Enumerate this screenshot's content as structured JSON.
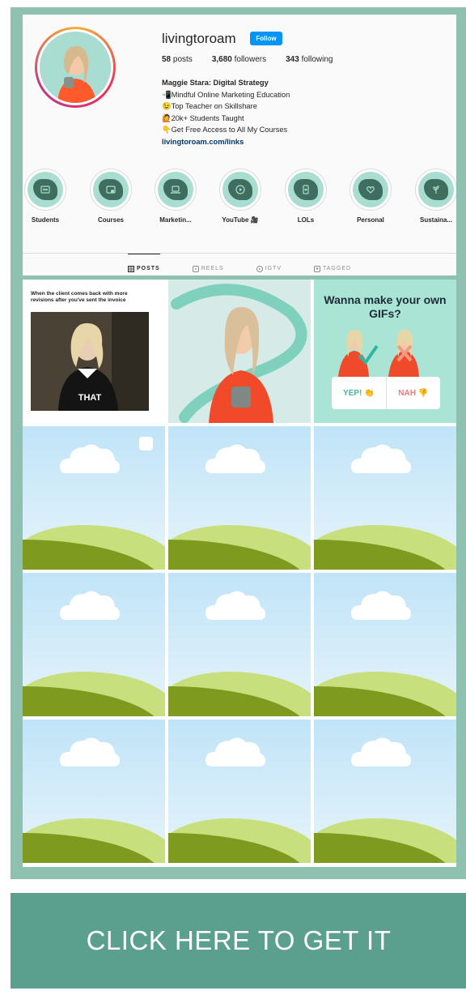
{
  "profile": {
    "username": "livingtoroam",
    "follow_label": "Follow",
    "stats": {
      "posts_count": "58",
      "posts_label": "posts",
      "followers_count": "3,680",
      "followers_label": "followers",
      "following_count": "343",
      "following_label": "following"
    },
    "bio": {
      "name": "Maggie Stara: Digital Strategy",
      "lines": [
        "📲Mindful Online Marketing Education",
        "😉Top Teacher on Skillshare",
        "🙋20k+ Students Taught",
        "👇Get Free Access to All My Courses"
      ],
      "link": "livingtoroam.com/links"
    }
  },
  "highlights": [
    {
      "label": "Students",
      "icon": "students-icon"
    },
    {
      "label": "Courses",
      "icon": "courses-icon"
    },
    {
      "label": "Marketin...",
      "icon": "laptop-icon"
    },
    {
      "label": "YouTube 🎥",
      "icon": "play-icon"
    },
    {
      "label": "LOLs",
      "icon": "phone-heart-icon"
    },
    {
      "label": "Personal",
      "icon": "heart-icon"
    },
    {
      "label": "Sustaina...",
      "icon": "plant-icon"
    }
  ],
  "tabs": [
    {
      "label": "POSTS",
      "icon": "grid-icon",
      "active": true
    },
    {
      "label": "REELS",
      "icon": "reels-icon",
      "active": false
    },
    {
      "label": "IGTV",
      "icon": "igtv-icon",
      "active": false
    },
    {
      "label": "TAGGED",
      "icon": "tag-icon",
      "active": false
    }
  ],
  "posts": {
    "post1": {
      "caption": "When the client comes back with more revisions after you've sent the invoice",
      "meme_text": "THAT"
    },
    "post3": {
      "title": "Wanna make your own GIFs?",
      "yes": "YEP! 👏",
      "nah": "NAH 👎"
    }
  },
  "cta": {
    "label": "CLICK HERE TO GET IT"
  },
  "colors": {
    "frame": "#8fc1b0",
    "cta": "#5b9f8e",
    "accent_blue": "#0095f6",
    "mint": "#a9ddd1",
    "dark_green": "#3f6e5f"
  }
}
